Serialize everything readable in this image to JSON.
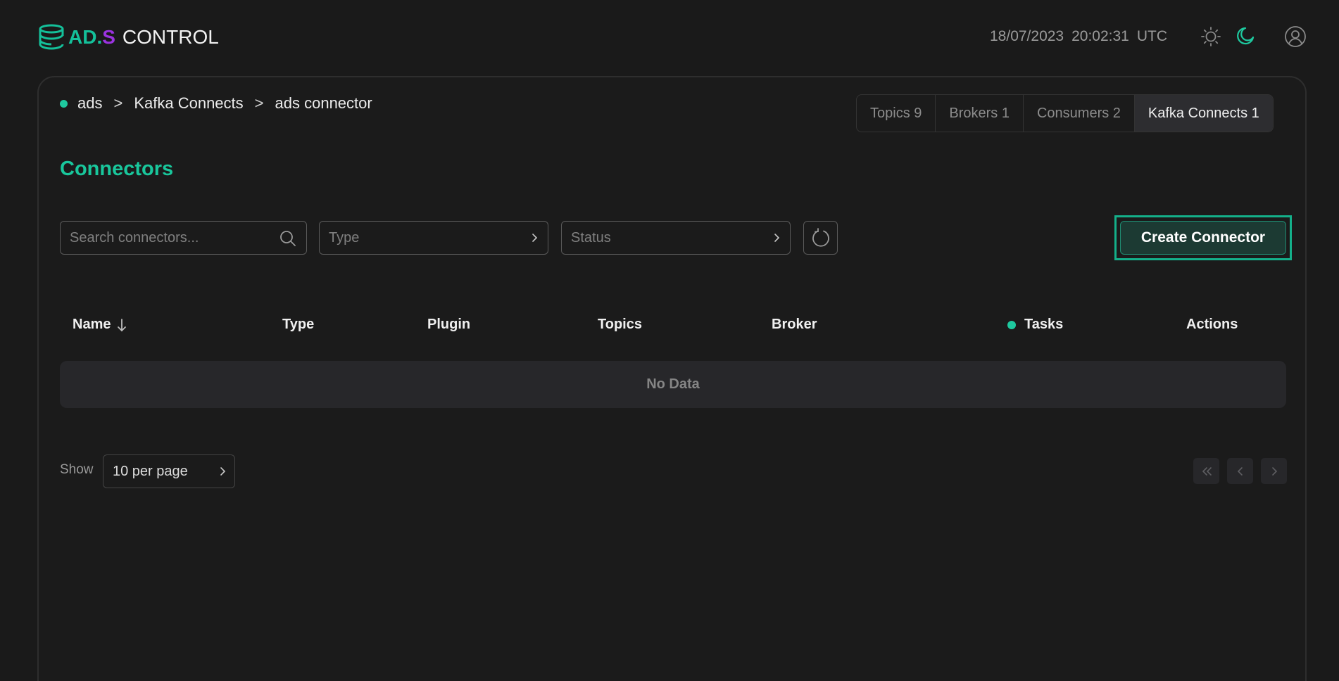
{
  "header": {
    "logo": {
      "ad": "AD",
      "dot": ".",
      "s": "S",
      "control": "CONTROL"
    },
    "date": "18/07/2023",
    "time": "20:02:31",
    "timezone": "UTC",
    "icons": [
      "sun-icon",
      "moon-icon",
      "user-icon"
    ],
    "accent_color": "#1ec99f"
  },
  "breadcrumb": {
    "items": [
      "ads",
      "Kafka Connects",
      "ads connector"
    ],
    "separator": ">"
  },
  "tabs": [
    {
      "label": "Topics 9",
      "active": false
    },
    {
      "label": "Brokers 1",
      "active": false
    },
    {
      "label": "Consumers 2",
      "active": false
    },
    {
      "label": "Kafka Connects 1",
      "active": true
    }
  ],
  "page": {
    "title": "Connectors"
  },
  "toolbar": {
    "search_placeholder": "Search connectors...",
    "type_placeholder": "Type",
    "status_placeholder": "Status",
    "create_label": "Create Connector"
  },
  "table": {
    "columns": [
      "Name",
      "Type",
      "Plugin",
      "Topics",
      "Broker",
      "Tasks",
      "Actions"
    ],
    "sort_column": "Name",
    "sort_direction": "descending",
    "empty_text": "No Data"
  },
  "pagination": {
    "show_label": "Show",
    "per_page": "10 per page"
  }
}
